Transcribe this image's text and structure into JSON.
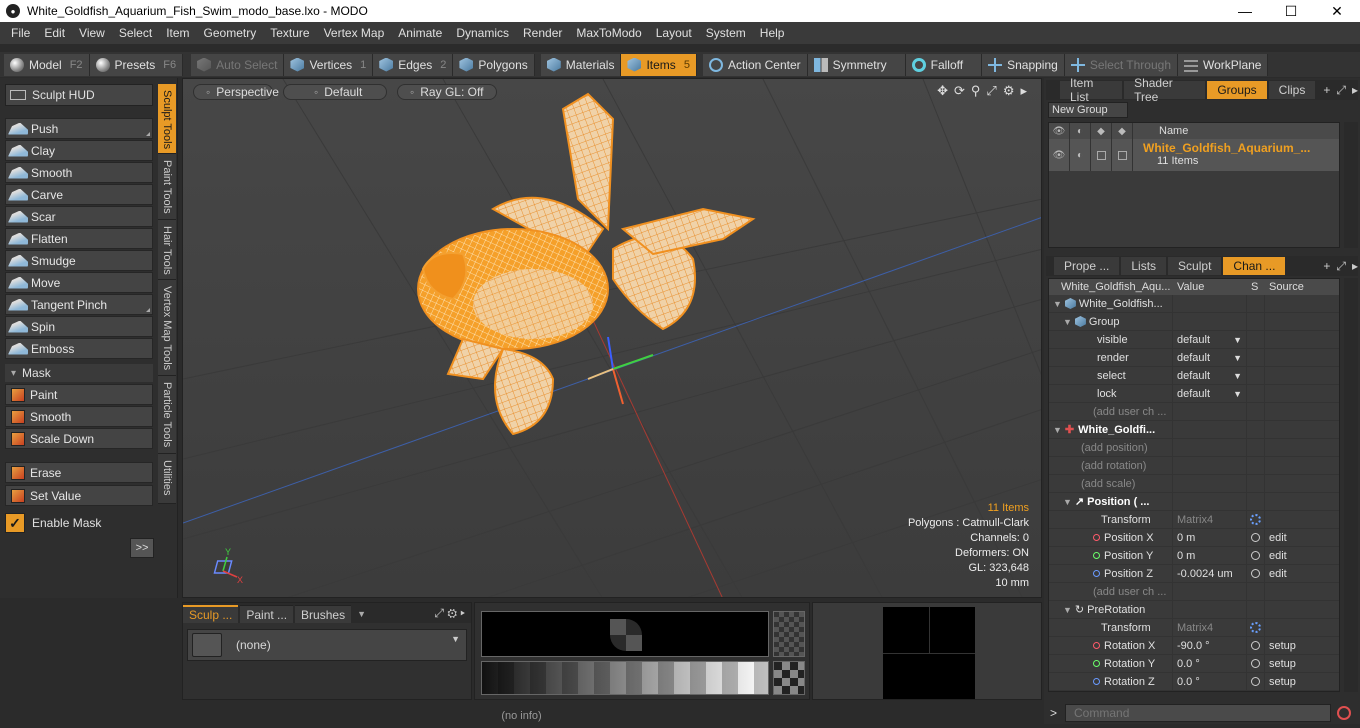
{
  "window": {
    "title": "White_Goldfish_Aquarium_Fish_Swim_modo_base.lxo - MODO",
    "minimize": "—",
    "maximize": "☐",
    "close": "✕"
  },
  "menu": [
    "File",
    "Edit",
    "View",
    "Select",
    "Item",
    "Geometry",
    "Texture",
    "Vertex Map",
    "Animate",
    "Dynamics",
    "Render",
    "MaxToModo",
    "Layout",
    "System",
    "Help"
  ],
  "toolbar": {
    "model": {
      "label": "Model",
      "key": "F2"
    },
    "presets": {
      "label": "Presets",
      "key": "F6"
    },
    "auto_select": "Auto Select",
    "vertices": {
      "label": "Vertices",
      "key": "1"
    },
    "edges": {
      "label": "Edges",
      "key": "2"
    },
    "polygons": "Polygons",
    "materials": "Materials",
    "items": {
      "label": "Items",
      "key": "5"
    },
    "action_center": "Action Center",
    "symmetry": "Symmetry",
    "falloff": "Falloff",
    "snapping": "Snapping",
    "select_through": "Select Through",
    "workplane": "WorkPlane"
  },
  "sculpt": {
    "hud": "Sculpt HUD",
    "tools": [
      "Push",
      "Clay",
      "Smooth",
      "Carve",
      "Scar",
      "Flatten",
      "Smudge",
      "Move",
      "Tangent Pinch",
      "Spin",
      "Emboss"
    ],
    "mask_header": "Mask",
    "mask_tools": [
      "Paint",
      "Smooth",
      "Scale Down"
    ],
    "erase": "Erase",
    "set_value": "Set Value",
    "enable_mask": "Enable Mask",
    "more": ">>",
    "vtabs": [
      "Sculpt Tools",
      "Paint Tools",
      "Hair Tools",
      "Vertex Map Tools",
      "Particle Tools",
      "Utilities"
    ]
  },
  "viewport": {
    "view": "Perspective",
    "style": "Default",
    "raygl": "Ray GL: Off",
    "info": {
      "items": "11 Items",
      "polygons": "Polygons : Catmull-Clark",
      "channels": "Channels: 0",
      "deformers": "Deformers: ON",
      "gl": "GL: 323,648",
      "scale": "10 mm"
    },
    "axis_y": "Y",
    "axis_x": "X"
  },
  "bottom_left": {
    "tabs": [
      "Sculp ...",
      "Paint ...",
      "Brushes"
    ],
    "dropdown_value": "(none)"
  },
  "status": "(no info)",
  "groups_panel": {
    "tabs": [
      "Item List",
      "Shader Tree",
      "Groups",
      "Clips"
    ],
    "new_group": "New Group",
    "col_name": "Name",
    "group_name": "White_Goldfish_Aquarium_...",
    "group_count": "11 Items"
  },
  "channels_panel": {
    "tabs": [
      "Prope ...",
      "Lists",
      "Sculpt",
      "Chan ..."
    ],
    "headers": [
      "White_Goldfish_Aqu...",
      "Value",
      "S",
      "Source"
    ],
    "rows": [
      {
        "name": "White_Goldfish...",
        "value": "",
        "src": ""
      },
      {
        "name": "Group",
        "value": "",
        "src": ""
      },
      {
        "name": "visible",
        "value": "default",
        "src": ""
      },
      {
        "name": "render",
        "value": "default",
        "src": ""
      },
      {
        "name": "select",
        "value": "default",
        "src": ""
      },
      {
        "name": "lock",
        "value": "default",
        "src": ""
      },
      {
        "name": "(add user ch ...",
        "value": "",
        "src": ""
      },
      {
        "name": "White_Goldfi...",
        "value": "",
        "src": ""
      },
      {
        "name": "(add position)",
        "value": "",
        "src": ""
      },
      {
        "name": "(add rotation)",
        "value": "",
        "src": ""
      },
      {
        "name": "(add scale)",
        "value": "",
        "src": ""
      },
      {
        "name": "Position ( ...",
        "value": "",
        "src": ""
      },
      {
        "name": "Transform",
        "value": "Matrix4",
        "src": ""
      },
      {
        "name": "Position X",
        "value": "0 m",
        "src": "edit"
      },
      {
        "name": "Position Y",
        "value": "0 m",
        "src": "edit"
      },
      {
        "name": "Position Z",
        "value": "-0.0024 um",
        "src": "edit"
      },
      {
        "name": "(add user ch ...",
        "value": "",
        "src": ""
      },
      {
        "name": "PreRotation",
        "value": "",
        "src": ""
      },
      {
        "name": "Transform",
        "value": "Matrix4",
        "src": ""
      },
      {
        "name": "Rotation X",
        "value": "-90.0 °",
        "src": "setup"
      },
      {
        "name": "Rotation Y",
        "value": "0.0 °",
        "src": "setup"
      },
      {
        "name": "Rotation Z",
        "value": "0.0 °",
        "src": "setup"
      }
    ]
  },
  "command": {
    "prompt": ">",
    "placeholder": "Command"
  },
  "colors": {
    "accent": "#e89a26",
    "viewport_bg": "#424242",
    "model_orange": "#f0901c"
  }
}
